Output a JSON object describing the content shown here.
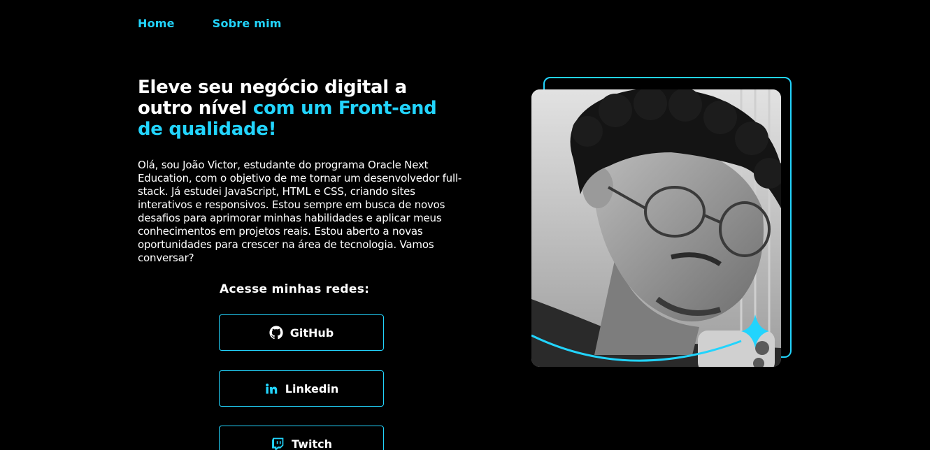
{
  "nav": {
    "items": [
      {
        "label": "Home"
      },
      {
        "label": "Sobre mim"
      }
    ]
  },
  "hero": {
    "headline_part1": "Eleve seu negócio digital a outro nível ",
    "headline_accent": "com um Front-end de qualidade!",
    "bio": "Olá, sou João Victor, estudante do programa Oracle Next Education, com o objetivo de me tornar um desenvolvedor full-stack. Já estudei JavaScript, HTML e CSS, criando sites interativos e responsivos. Estou sempre em busca de novos desafios para aprimorar minhas habilidades e aplicar meus conhecimentos em projetos reais. Estou aberto a novas oportunidades para crescer na área de tecnologia. Vamos conversar?"
  },
  "socials": {
    "title": "Acesse minhas redes:",
    "links": [
      {
        "label": "GitHub",
        "icon": "github-icon"
      },
      {
        "label": "Linkedin",
        "icon": "linkedin-icon"
      },
      {
        "label": "Twitch",
        "icon": "twitch-icon"
      }
    ]
  },
  "colors": {
    "background": "#000000",
    "accent": "#22d4fd",
    "text": "#ffffff"
  }
}
